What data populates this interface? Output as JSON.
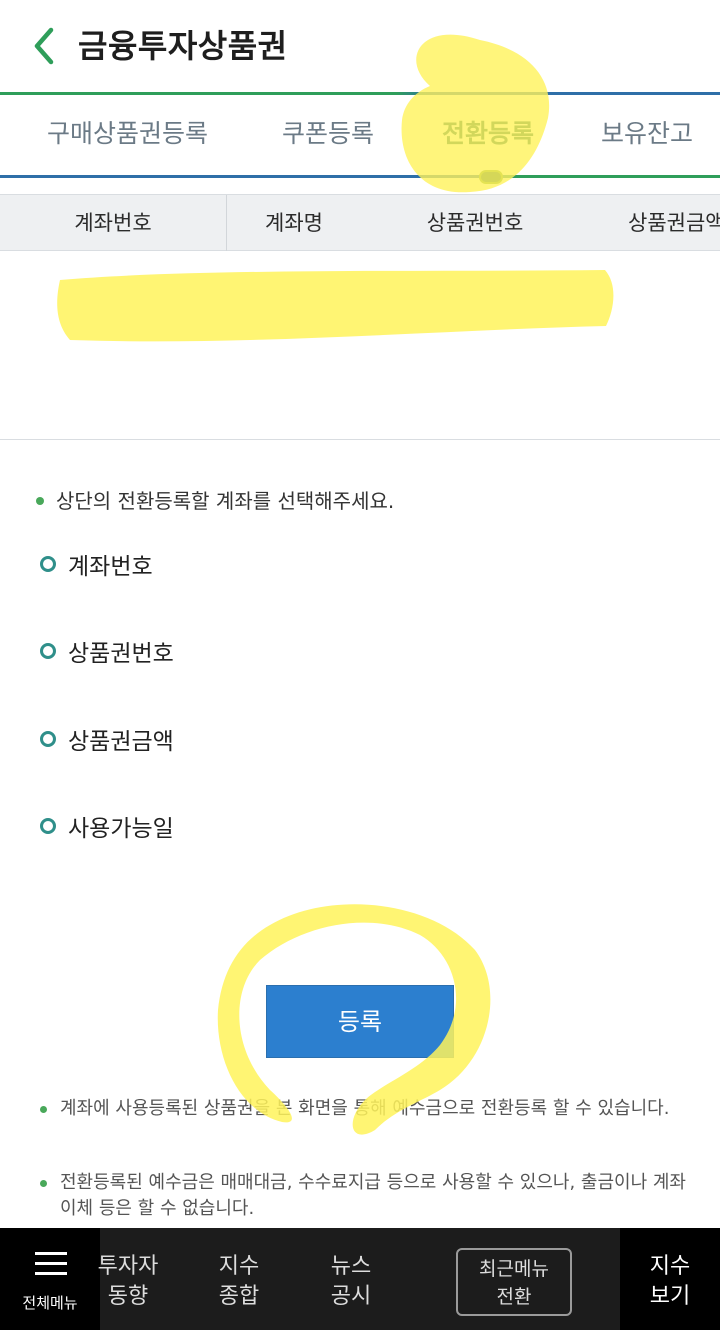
{
  "header": {
    "title": "금융투자상품권",
    "back_icon": "chevron-left-icon"
  },
  "tabs": [
    {
      "label": "구매상품권등록",
      "active": false
    },
    {
      "label": "쿠폰등록",
      "active": false
    },
    {
      "label": "전환등록",
      "active": true
    },
    {
      "label": "보유잔고",
      "active": false
    }
  ],
  "table": {
    "columns": [
      "계좌번호",
      "계좌명",
      "상품권번호",
      "상품권금액"
    ]
  },
  "info": {
    "instruction": "상단의 전환등록할 계좌를 선택해주세요.",
    "fields": [
      "계좌번호",
      "상품권번호",
      "상품권금액",
      "사용가능일"
    ]
  },
  "register_button": "등록",
  "notes": [
    "계좌에 사용등록된 상품권을 본 화면을 통해 예수금으로 전환등록 할 수 있습니다.",
    "전환등록된 예수금은 매매대금, 수수료지급 등으로 사용할 수 있으나, 출금이나 계좌이체 등은 할 수 없습니다."
  ],
  "bottom_nav": {
    "menu_all": "전체메뉴",
    "items": [
      {
        "line1": "투자자",
        "line2": "동향"
      },
      {
        "line1": "지수",
        "line2": "종합"
      },
      {
        "line1": "뉴스",
        "line2": "공시"
      }
    ],
    "recent": {
      "line1": "최근메뉴",
      "line2": "전환"
    },
    "index_view": {
      "line1": "지수",
      "line2": "보기"
    }
  },
  "colors": {
    "accent_green": "#2f9e5a",
    "accent_blue": "#2e6fa8",
    "button_blue": "#2c7fcf",
    "highlighter": "#fff35a"
  }
}
